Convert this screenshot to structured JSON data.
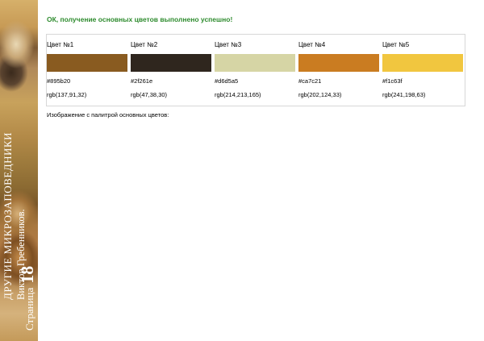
{
  "sidebar": {
    "title": "ДРУГИЕ МИКРОЗАПОВЕДНИКИ",
    "author": "Виктор Гребенников.",
    "page_prefix": "Страница",
    "page_number": "18"
  },
  "status": {
    "message": "ОК, получение основных цветов выполнено успешно!",
    "color": "#2e8b2e"
  },
  "palette": {
    "colors": [
      {
        "label": "Цвет №1",
        "hex": "#895b20",
        "rgb": "rgb(137,91,32)"
      },
      {
        "label": "Цвет №2",
        "hex": "#2f261e",
        "rgb": "rgb(47,38,30)"
      },
      {
        "label": "Цвет №3",
        "hex": "#d6d5a5",
        "rgb": "rgb(214,213,165)"
      },
      {
        "label": "Цвет №4",
        "hex": "#ca7c21",
        "rgb": "rgb(202,124,33)"
      },
      {
        "label": "Цвет №5",
        "hex": "#f1c63f",
        "rgb": "rgb(241,198,63)"
      }
    ]
  },
  "caption": "Изображение с палитрой основных цветов:"
}
